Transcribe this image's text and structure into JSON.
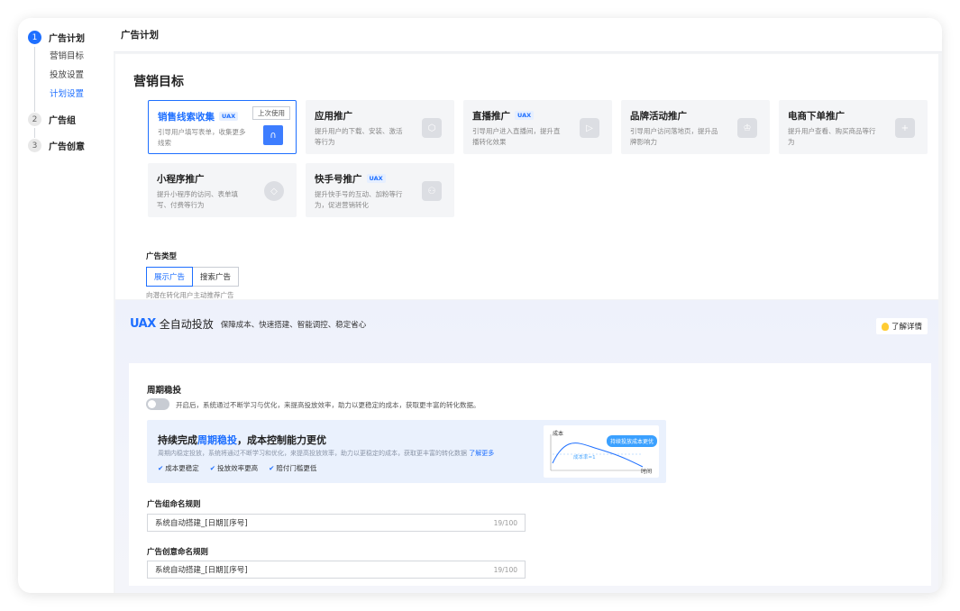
{
  "nav": {
    "steps": [
      {
        "num": "1",
        "label": "广告计划"
      },
      {
        "num": "2",
        "label": "广告组"
      },
      {
        "num": "3",
        "label": "广告创意"
      }
    ],
    "subitems": [
      "营销目标",
      "投放设置",
      "计划设置"
    ]
  },
  "topbar": {
    "title": "广告计划"
  },
  "marketing": {
    "title": "营销目标",
    "last_used": "上次使用",
    "cards": [
      {
        "title": "销售线索收集",
        "tag": "UAX",
        "desc": "引导用户填写表单，收集更多线索",
        "icon": "form-icon"
      },
      {
        "title": "应用推广",
        "tag": "",
        "desc": "提升用户的下载、安装、激活等行为",
        "icon": "cube-icon"
      },
      {
        "title": "直播推广",
        "tag": "UAX",
        "desc": "引导用户进入直播间，提升直播转化效果",
        "icon": "play-icon"
      },
      {
        "title": "品牌活动推广",
        "tag": "",
        "desc": "引导用户访问落地页，提升品牌影响力",
        "icon": "crown-icon"
      },
      {
        "title": "电商下单推广",
        "tag": "",
        "desc": "提升用户查看、购买商品等行为",
        "icon": "cart-icon"
      },
      {
        "title": "小程序推广",
        "tag": "",
        "desc": "提升小程序的访问、表单填写、付费等行为",
        "icon": "miniapp-icon"
      },
      {
        "title": "快手号推广",
        "tag": "UAX",
        "desc": "提升快手号的互动、加粉等行为，促进营销转化",
        "icon": "user-icon"
      }
    ]
  },
  "ad_type": {
    "label": "广告类型",
    "options": [
      "展示广告",
      "搜索广告"
    ],
    "hint": "向潜在转化用户主动推荐广告"
  },
  "uax": {
    "logo": "UAX",
    "name": "全自动投放",
    "slogan": "保障成本、快速搭建、智能调控、稳定省心",
    "learn_more": "了解详情",
    "cycle_title": "周期稳投",
    "toggle_desc": "开启后，系统通过不断学习与优化，来提高投放效率，助力以更稳定的成本，获取更丰富的转化数据。",
    "promo_title_a": "持续完成",
    "promo_title_hl": "周期稳投",
    "promo_title_b": "，成本控制能力更优",
    "promo_desc": "周期内稳定投放，系统将通过不断学习和优化，来提高投放效率，助力以更稳定的成本，获取更丰富的转化数据",
    "promo_link": "了解更多",
    "checks": [
      "成本更稳定",
      "投放效率更高",
      "赔付门槛更低"
    ],
    "chart_cost_label": "成本",
    "chart_pill": "持续投放成本更优",
    "chart_cost_eq": "成本率=1",
    "chart_time": "时间",
    "group_label": "广告组命名规则",
    "group_value": "系统自动搭建_[日期][序号]",
    "group_count": "19/100",
    "creative_label": "广告创意命名规则",
    "creative_value": "系统自动搭建_[日期][序号]",
    "creative_count": "19/100"
  },
  "colors": {
    "accent": "#1e6fff",
    "panel_bg": "#f4f5f7"
  }
}
